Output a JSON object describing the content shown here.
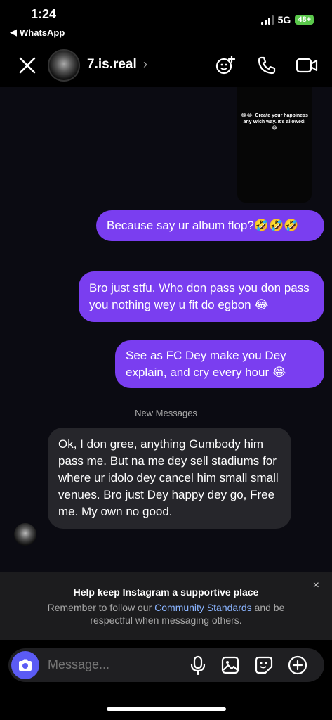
{
  "status_bar": {
    "time": "1:24",
    "back_app": "WhatsApp",
    "network": "5G",
    "battery": "48+"
  },
  "header": {
    "username": "7.is.real",
    "chevron": "›",
    "icons": [
      "close-icon",
      "add-effect-icon",
      "phone-icon",
      "video-call-icon"
    ]
  },
  "reel": {
    "caption": "😂😂. Create your happiness any Wich way. It's allowed! 😂"
  },
  "messages": [
    {
      "from": "me",
      "text": "Because say ur album flop?🤣🤣🤣"
    },
    {
      "from": "me",
      "text": "Bro just stfu. Who don pass you don pass you nothing wey u fit do egbon 😂"
    },
    {
      "from": "me",
      "text": "See as FC Dey make you Dey explain, and cry every hour 😂"
    },
    {
      "from": "them",
      "text": "Ok, I don gree, anything Gumbody him pass me. But na me dey sell stadiums for where ur idolo dey cancel him small small venues. Bro just Dey happy dey go, Free me. My own no good."
    }
  ],
  "divider_label": "New Messages",
  "notice": {
    "title": "Help keep Instagram a supportive place",
    "body_prefix": "Remember to follow our ",
    "link": "Community Standards",
    "body_suffix": " and be respectful when messaging others.",
    "close": "×"
  },
  "composer": {
    "placeholder": "Message...",
    "icons": [
      "camera-icon",
      "microphone-icon",
      "gallery-icon",
      "sticker-icon",
      "plus-icon"
    ]
  },
  "colors": {
    "outgoing_bubble": "#7a3ef0",
    "incoming_bubble": "#26262b",
    "camera_button": "#5b5bf5",
    "link": "#8ab4ff"
  }
}
